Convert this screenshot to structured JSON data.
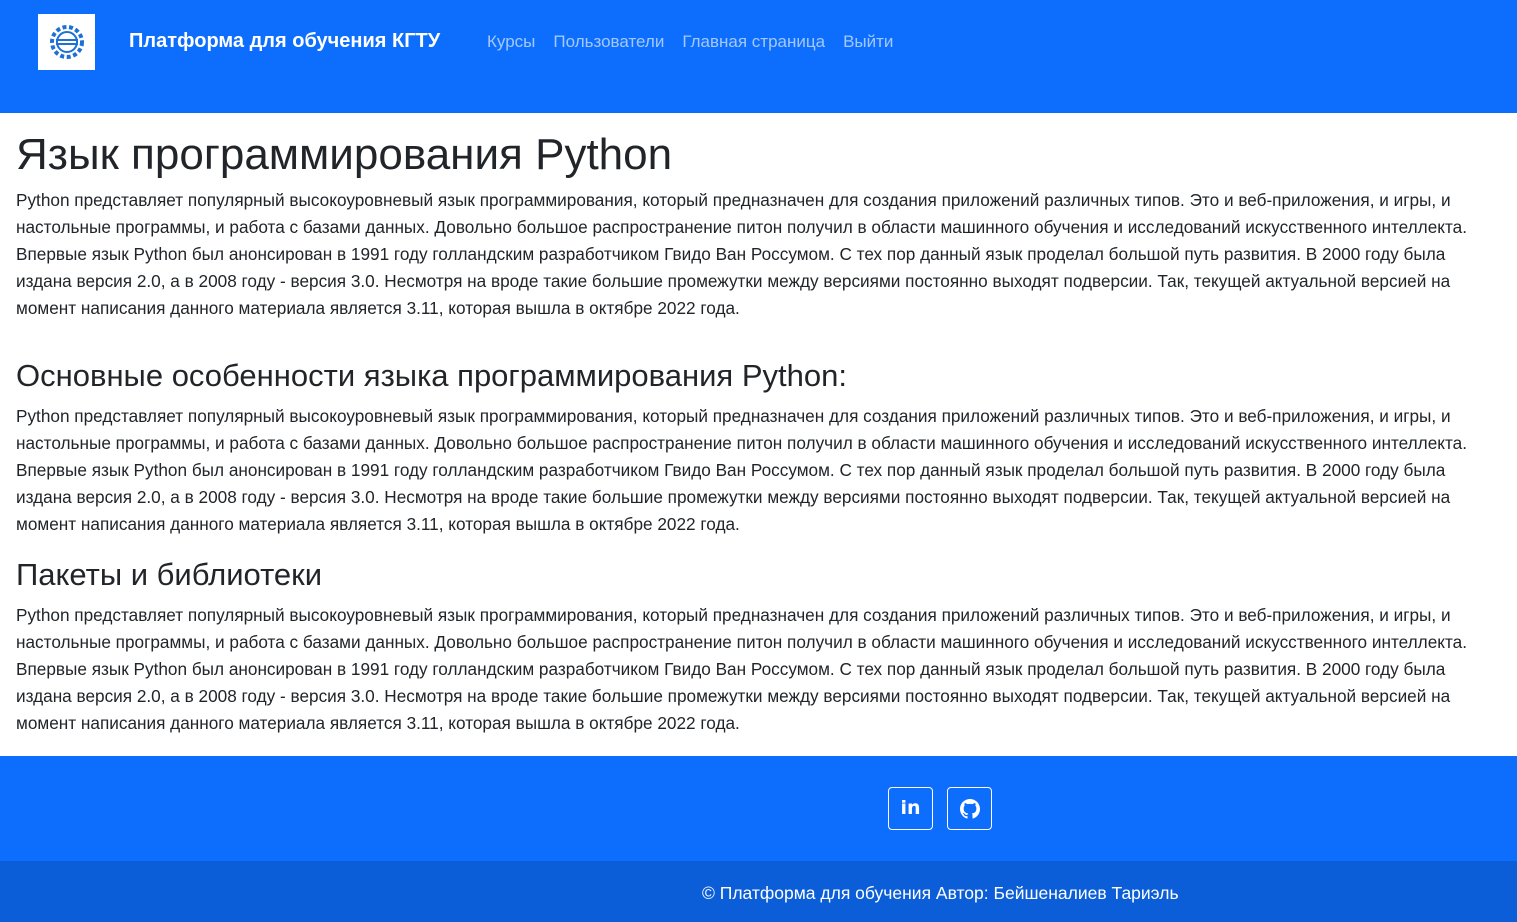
{
  "navbar": {
    "brand": "Платформа для обучения КГТУ",
    "links": [
      "Курсы",
      "Пользователи",
      "Главная страница",
      "Выйти"
    ],
    "logo_icon": "gear-logo-icon",
    "bg_color": "#0d6efd"
  },
  "main": {
    "title": "Язык программирования Python",
    "intro": "Python представляет популярный высокоуровневый язык программирования, который предназначен для создания приложений различных типов. Это и веб-приложения, и игры, и настольные программы, и работа с базами данных. Довольно большое распространение питон получил в области машинного обучения и исследований искусственного интеллекта. Впервые язык Python был анонсирован в 1991 году голландским разработчиком Гвидо Ван Россумом. С тех пор данный язык проделал большой путь развития. В 2000 году была издана версия 2.0, а в 2008 году - версия 3.0. Несмотря на вроде такие большие промежутки между версиями постоянно выходят подверсии. Так, текущей актуальной версией на момент написания данного материала является 3.11, которая вышла в октябре 2022 года.",
    "sections": [
      {
        "heading": "Основные особенности языка программирования Python:",
        "text": "Python представляет популярный высокоуровневый язык программирования, который предназначен для создания приложений различных типов. Это и веб-приложения, и игры, и настольные программы, и работа с базами данных. Довольно большое распространение питон получил в области машинного обучения и исследований искусственного интеллекта. Впервые язык Python был анонсирован в 1991 году голландским разработчиком Гвидо Ван Россумом. С тех пор данный язык проделал большой путь развития. В 2000 году была издана версия 2.0, а в 2008 году - версия 3.0. Несмотря на вроде такие большие промежутки между версиями постоянно выходят подверсии. Так, текущей актуальной версией на момент написания данного материала является 3.11, которая вышла в октябре 2022 года."
      },
      {
        "heading": "Пакеты и библиотеки",
        "text": "Python представляет популярный высокоуровневый язык программирования, который предназначен для создания приложений различных типов. Это и веб-приложения, и игры, и настольные программы, и работа с базами данных. Довольно большое распространение питон получил в области машинного обучения и исследований искусственного интеллекта. Впервые язык Python был анонсирован в 1991 году голландским разработчиком Гвидо Ван Россумом. С тех пор данный язык проделал большой путь развития. В 2000 году была издана версия 2.0, а в 2008 году - версия 3.0. Несмотря на вроде такие большие промежутки между версиями постоянно выходят подверсии. Так, текущей актуальной версией на момент написания данного материала является 3.11, которая вышла в октябре 2022 года."
      }
    ]
  },
  "footer": {
    "social": [
      {
        "icon": "linkedin-icon",
        "text": "in"
      },
      {
        "icon": "github-icon"
      }
    ],
    "copyright": "© Платформа для обучения Автор: Бейшеналиев Тариэль",
    "top_color": "#0d6efd",
    "bottom_color": "#0b5ed7"
  }
}
